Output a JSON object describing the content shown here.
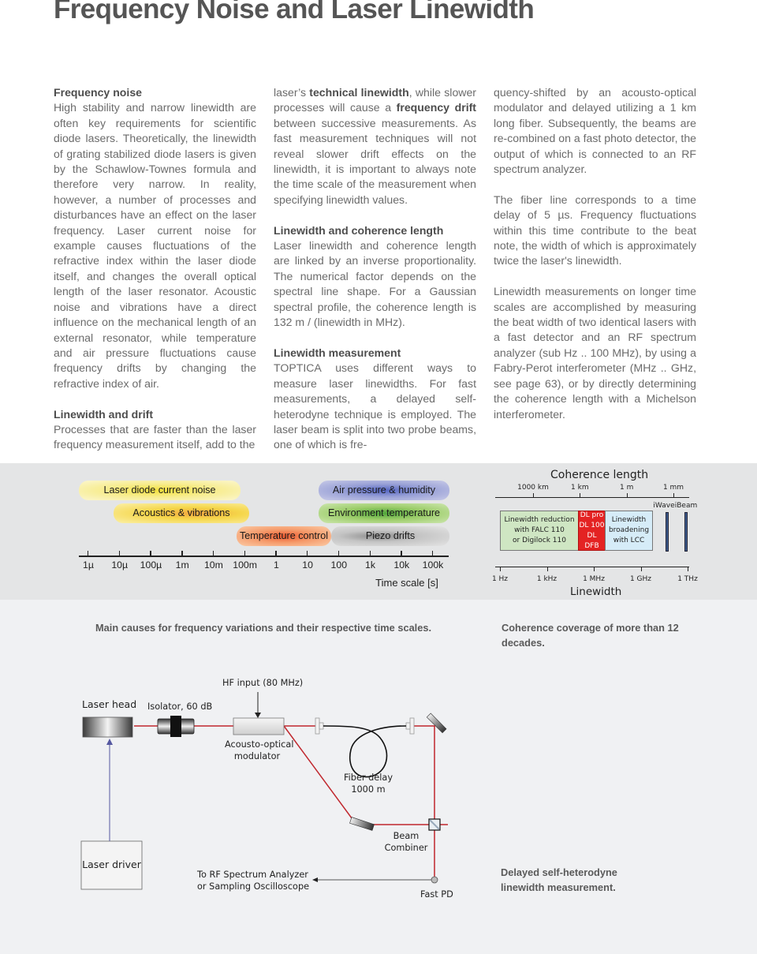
{
  "page": {
    "title": "Frequency Noise and Laser Linewidth"
  },
  "columns": {
    "col1": {
      "h1": "Frequency noise",
      "p1": "High stability and narrow linewidth are often key requirements for scientific diode lasers. Theoretically, the linewidth of grating stabilized diode lasers is given by the Schawlow-Townes formula and therefore very narrow. In reality, however, a number of processes and disturbances have an effect on the laser frequency. Laser current noise for example causes fluctuations of the refractive index within the laser diode itself, and changes the overall optical length of the laser resonator. Acoustic noise and vibrations have a direct influence on the mechanical length of an external resonator, while temperature and air pressure fluctuations cause frequency drifts by changing the refractive index of air.",
      "h2": "Linewidth and drift",
      "p2": "Processes that are faster than the laser frequency measurement itself, add to the"
    },
    "col2": {
      "p1_a": "laser’s ",
      "p1_b1": "technical linewidth",
      "p1_c": ", while slower processes will cause a ",
      "p1_b2": "frequency drift",
      "p1_d": " between successive measurements. As fast measurement techniques will not reveal slower drift effects on the linewidth, it is important to always note the time scale of the measurement when specifying linewidth values.",
      "h1": "Linewidth and coherence length",
      "p2": "Laser linewidth and coherence length are linked by an inverse proportionality. The numerical factor depends on the spectral line shape. For a Gaussian spectral profile, the coherence length is 132 m / (linewidth in MHz).",
      "h2": "Linewidth measurement",
      "p3": "TOPTICA uses different ways to measure laser linewidths. For fast measurements, a delayed self-heterodyne technique is employed. The laser beam is split into two probe beams, one of which is fre-"
    },
    "col3": {
      "p1": "quency-shifted by an acousto-optical modulator and delayed utilizing a 1 km long fiber. Subsequently, the beams are re-combined on a fast photo detector, the output of which is connected to an RF spectrum analyzer.",
      "p2": "The fiber line corresponds to a time delay of 5 µs. Frequency fluctuations within this time contribute to the beat note, the width of which is approximately twice the laser's linewidth.",
      "p3": "Linewidth measurements on longer time scales are accomplished by measuring the beat width of two identical lasers with a fast detector and an RF spectrum analyzer (sub Hz .. 100 MHz), by using a Fabry-Perot interferometer (MHz .. GHz, see page 63), or by directly determining the coherence length with a Michelson interferometer."
    }
  },
  "timescale_figure": {
    "causes": [
      {
        "label": "Laser diode current noise",
        "from": "1µ",
        "to": "100m",
        "color": "#f8ec8a"
      },
      {
        "label": "Acoustics & vibrations",
        "from": "10µ",
        "to": "100m",
        "color": "#f6d24a"
      },
      {
        "label": "Temperature control",
        "from": "100m",
        "to": "100",
        "color": "#f6a06a"
      },
      {
        "label": "Air pressure & humidity",
        "from": "100",
        "to": "100k",
        "color": "#9aa2d8"
      },
      {
        "label": "Environment temperature",
        "from": "100",
        "to": "100k",
        "color": "#a6cf6e"
      },
      {
        "label": "Piezo drifts",
        "from": "100",
        "to": "100k",
        "color": "#c8c8c8"
      }
    ],
    "ticks": [
      "1µ",
      "10µ",
      "100µ",
      "1m",
      "10m",
      "100m",
      "1",
      "10",
      "100",
      "1k",
      "10k",
      "100k"
    ],
    "axis_label": "Time scale [s]",
    "caption": "Main causes for frequency variations and their respective time scales."
  },
  "coherence_figure": {
    "title": "Coherence length",
    "coherence_ticks": [
      "1000 km",
      "1 km",
      "1 m",
      "1 mm"
    ],
    "regions": [
      {
        "lines": [
          "Linewidth reduction",
          "with FALC 110",
          "or Digilock 110"
        ],
        "color": "#cfe6c3"
      },
      {
        "lines": [
          "DL pro",
          "DL 100",
          "DL DFB"
        ],
        "color": "#e42323"
      },
      {
        "lines": [
          "Linewidth",
          "broadening",
          "with LCC"
        ],
        "color": "#d6ecf8"
      }
    ],
    "products": [
      "iWave",
      "iBeam"
    ],
    "linewidth_ticks": [
      "1 Hz",
      "1 kHz",
      "1 MHz",
      "1 GHz",
      "1 THz"
    ],
    "linewidth_label": "Linewidth",
    "caption": "Coherence coverage of more than 12 decades."
  },
  "setup_diagram": {
    "labels": {
      "hf_input": "HF input (80 MHz)",
      "laser_head": "Laser  head",
      "isolator": "Isolator, 60 dB",
      "aom_1": "Acousto-optical",
      "aom_2": "modulator",
      "fiber_1": "Fiber delay",
      "fiber_2": "1000  m",
      "combiner_1": "Beam",
      "combiner_2": "Combiner",
      "laser_driver": "Laser driver",
      "output_1": "To RF Spectrum  Analyzer",
      "output_2": "or Sampling  Oscilloscope",
      "fast_pd": "Fast  PD"
    },
    "caption": "Delayed self-heterodyne linewidth measurement."
  }
}
